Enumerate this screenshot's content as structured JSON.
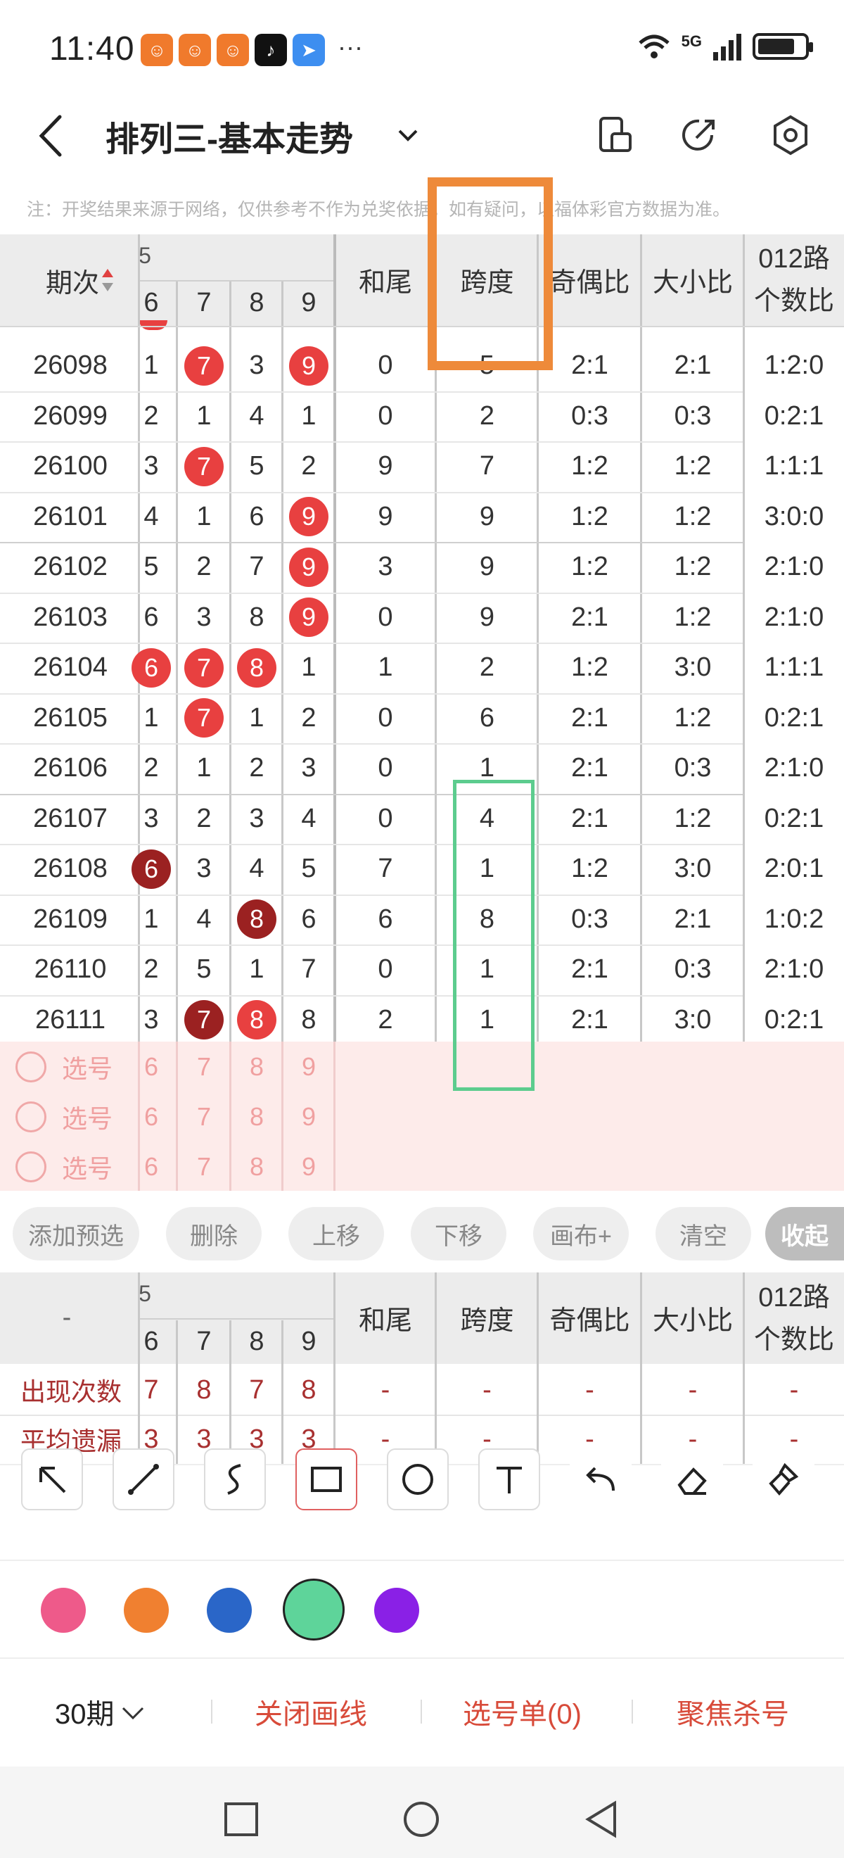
{
  "status_bar": {
    "time": "11:40",
    "network": "5G",
    "more": "···"
  },
  "header": {
    "title": "排列三-基本走势"
  },
  "note": "注：开奖结果来源于网络，仅供参考不作为兑奖依据。如有疑问，以福体彩官方数据为准。",
  "table": {
    "header_issue": "期次",
    "digit_cols": [
      "6",
      "7",
      "8",
      "9"
    ],
    "columns": [
      "和尾",
      "跨度",
      "奇偶比",
      "大小比",
      "012路",
      "个数比"
    ],
    "rows": [
      {
        "issue": "26098",
        "d": [
          "1",
          "7",
          "3",
          "9"
        ],
        "hewei": "0",
        "kuadu": "5",
        "jiou": "2:1",
        "daxiao": "2:1",
        "lu": "1:2:0"
      },
      {
        "issue": "26099",
        "d": [
          "2",
          "1",
          "4",
          "1"
        ],
        "hewei": "0",
        "kuadu": "2",
        "jiou": "0:3",
        "daxiao": "0:3",
        "lu": "0:2:1"
      },
      {
        "issue": "26100",
        "d": [
          "3",
          "7",
          "5",
          "2"
        ],
        "hewei": "9",
        "kuadu": "7",
        "jiou": "1:2",
        "daxiao": "1:2",
        "lu": "1:1:1"
      },
      {
        "issue": "26101",
        "d": [
          "4",
          "1",
          "6",
          "9"
        ],
        "hewei": "9",
        "kuadu": "9",
        "jiou": "1:2",
        "daxiao": "1:2",
        "lu": "3:0:0"
      },
      {
        "issue": "26102",
        "d": [
          "5",
          "2",
          "7",
          "9"
        ],
        "hewei": "3",
        "kuadu": "9",
        "jiou": "1:2",
        "daxiao": "1:2",
        "lu": "2:1:0"
      },
      {
        "issue": "26103",
        "d": [
          "6",
          "3",
          "8",
          "9"
        ],
        "hewei": "0",
        "kuadu": "9",
        "jiou": "2:1",
        "daxiao": "1:2",
        "lu": "2:1:0"
      },
      {
        "issue": "26104",
        "d": [
          "6",
          "7",
          "8",
          "1"
        ],
        "hewei": "1",
        "kuadu": "2",
        "jiou": "1:2",
        "daxiao": "3:0",
        "lu": "1:1:1"
      },
      {
        "issue": "26105",
        "d": [
          "1",
          "7",
          "1",
          "2"
        ],
        "hewei": "0",
        "kuadu": "6",
        "jiou": "2:1",
        "daxiao": "1:2",
        "lu": "0:2:1"
      },
      {
        "issue": "26106",
        "d": [
          "2",
          "1",
          "2",
          "3"
        ],
        "hewei": "0",
        "kuadu": "1",
        "jiou": "2:1",
        "daxiao": "0:3",
        "lu": "2:1:0"
      },
      {
        "issue": "26107",
        "d": [
          "3",
          "2",
          "3",
          "4"
        ],
        "hewei": "0",
        "kuadu": "4",
        "jiou": "2:1",
        "daxiao": "1:2",
        "lu": "0:2:1"
      },
      {
        "issue": "26108",
        "d": [
          "6",
          "3",
          "4",
          "5"
        ],
        "hewei": "7",
        "kuadu": "1",
        "jiou": "1:2",
        "daxiao": "3:0",
        "lu": "2:0:1"
      },
      {
        "issue": "26109",
        "d": [
          "1",
          "4",
          "8",
          "6"
        ],
        "hewei": "6",
        "kuadu": "8",
        "jiou": "0:3",
        "daxiao": "2:1",
        "lu": "1:0:2"
      },
      {
        "issue": "26110",
        "d": [
          "2",
          "5",
          "1",
          "7"
        ],
        "hewei": "0",
        "kuadu": "1",
        "jiou": "2:1",
        "daxiao": "0:3",
        "lu": "2:1:0"
      },
      {
        "issue": "26111",
        "d": [
          "3",
          "7",
          "8",
          "8"
        ],
        "hewei": "2",
        "kuadu": "1",
        "jiou": "2:1",
        "daxiao": "3:0",
        "lu": "0:2:1"
      }
    ],
    "select_label": "选号",
    "select_digits": [
      "6",
      "7",
      "8",
      "9"
    ]
  },
  "buttons": {
    "add": "添加预选",
    "delete": "删除",
    "up": "上移",
    "down": "下移",
    "canvas": "画布+",
    "clear": "清空",
    "collapse": "收起"
  },
  "stats": {
    "dash": "-",
    "rows": [
      {
        "label": "出现次数",
        "d": [
          "7",
          "8",
          "7",
          "8"
        ]
      },
      {
        "label": "平均遗漏",
        "d": [
          "3",
          "3",
          "3",
          "3"
        ]
      }
    ]
  },
  "colors": [
    "#ee5a8a",
    "#f08030",
    "#2a66c8",
    "#5ed49a",
    "#8a20e6"
  ],
  "bottom": {
    "period": "30期",
    "close_draw": "关闭画线",
    "pick_list": "选号单(0)",
    "focus_kill": "聚焦杀号"
  },
  "partial_col_label": "5"
}
